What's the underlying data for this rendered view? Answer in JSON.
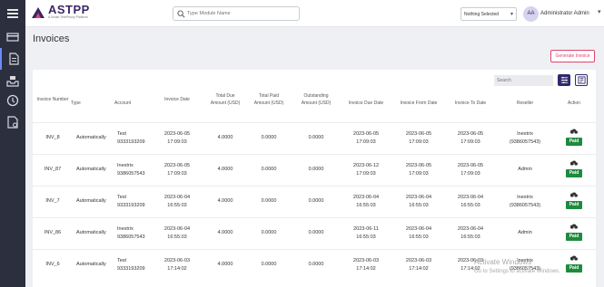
{
  "header": {
    "logo_name": "ASTPP",
    "logo_tagline": "A Smart TelePhony Platform",
    "search_placeholder": "Type Module Name",
    "selector_value": "Nothing Selected",
    "user_initials": "AA",
    "user_name": "Administrator Admin"
  },
  "sidebar": {
    "items": [
      {
        "icon": "menu-icon"
      },
      {
        "icon": "card-icon"
      },
      {
        "icon": "invoice-icon"
      },
      {
        "icon": "inbox-icon"
      },
      {
        "icon": "history-icon"
      },
      {
        "icon": "report-icon"
      }
    ]
  },
  "page": {
    "title": "Invoices",
    "generate_button": "Generate Invoice",
    "table_search_placeholder": "Search"
  },
  "table": {
    "columns": [
      "Invoice Number",
      "Type",
      "Account",
      "Invoice Date",
      "Total Due Amount (USD)",
      "Total Paid Amount (USD)",
      "Outstanding Amount (USD)",
      "Invoice Due Date",
      "Invoice From Date",
      "Invoice To Date",
      "Reseller",
      "Action"
    ],
    "rows": [
      {
        "number": "INV_8",
        "type": "Automatically",
        "account": "Test\n9333193209",
        "date": "2023-06-05\n17:09:03",
        "total_due": "4.0000",
        "total_paid": "0.0000",
        "outstanding": "0.0000",
        "due_date": "2023-06-05\n17:09:03",
        "from_date": "2023-06-05\n17:09:03",
        "to_date": "2023-06-05\n17:09:03",
        "reseller": "Inextrix\n(9386057543)",
        "status": "Paid"
      },
      {
        "number": "INV_87",
        "type": "Automatically",
        "account": "Inextrix\n9386057543",
        "date": "2023-06-05\n17:09:03",
        "total_due": "4.0000",
        "total_paid": "0.0000",
        "outstanding": "0.0000",
        "due_date": "2023-06-12\n17:09:03",
        "from_date": "2023-06-05\n17:09:03",
        "to_date": "2023-06-05\n17:09:03",
        "reseller": "Admin",
        "status": "Paid"
      },
      {
        "number": "INV_7",
        "type": "Automatically",
        "account": "Test\n9333193209",
        "date": "2023-06-04\n16:55:03",
        "total_due": "4.0000",
        "total_paid": "0.0000",
        "outstanding": "0.0000",
        "due_date": "2023-06-04\n16:55:03",
        "from_date": "2023-06-04\n16:55:03",
        "to_date": "2023-06-04\n16:55:03",
        "reseller": "Inextrix\n(9386057543)",
        "status": "Paid"
      },
      {
        "number": "INV_86",
        "type": "Automatically",
        "account": "Inextrix\n9386057543",
        "date": "2023-06-04\n16:55:03",
        "total_due": "4.0000",
        "total_paid": "0.0000",
        "outstanding": "0.0000",
        "due_date": "2023-06-11\n16:55:03",
        "from_date": "2023-06-04\n16:55:03",
        "to_date": "2023-06-04\n16:55:03",
        "reseller": "Admin",
        "status": "Paid"
      },
      {
        "number": "INV_6",
        "type": "Automatically",
        "account": "Test\n9333193209",
        "date": "2023-06-03\n17:14:02",
        "total_due": "4.0000",
        "total_paid": "0.0000",
        "outstanding": "0.0000",
        "due_date": "2023-06-03\n17:14:02",
        "from_date": "2023-06-03\n17:14:02",
        "to_date": "2023-06-03\n17:14:02",
        "reseller": "Inextrix\n(9386057543)",
        "status": "Paid"
      }
    ]
  },
  "watermark": {
    "line1": "Activate Windows",
    "line2": "Go to Settings to activate Windows."
  },
  "colors": {
    "sidebar": "#2b2f3e",
    "brand": "#3a2666",
    "accent_pink": "#e2446c",
    "paid_green": "#1e8a3e"
  }
}
